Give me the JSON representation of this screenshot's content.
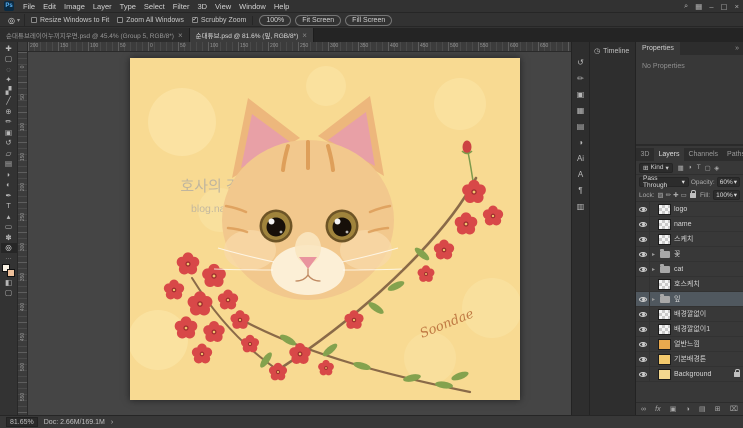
{
  "glyphs": {
    "caret_down": "▾",
    "group_caret": "▸",
    "collapse": "»",
    "tab_close": "×",
    "check": "✓",
    "status_arrow": "›",
    "kind_icon": "⊞"
  },
  "colors": {
    "canvas_yellow": "#f8da92",
    "flower_red": "#d84848",
    "leaf_green": "#84a24e",
    "cat_fur": "#f2c88d",
    "selection_gray": "#50585f"
  },
  "menubar": {
    "logo": "Ps",
    "items": [
      "File",
      "Edit",
      "Image",
      "Layer",
      "Type",
      "Select",
      "Filter",
      "3D",
      "View",
      "Window",
      "Help"
    ],
    "right_icons": [
      {
        "name": "search-icon",
        "glyph": "⌕"
      },
      {
        "name": "workspace-icon",
        "glyph": "▦"
      },
      {
        "name": "minimize-icon",
        "glyph": "–"
      },
      {
        "name": "restore-icon",
        "glyph": "▢"
      },
      {
        "name": "close-icon",
        "glyph": "×"
      }
    ]
  },
  "options_bar": {
    "tool_glyph": "◎",
    "checkboxes": [
      {
        "label": "Resize Windows to Fit",
        "checked": false
      },
      {
        "label": "Zoom All Windows",
        "checked": false
      },
      {
        "label": "Scrubby Zoom",
        "checked": true
      }
    ],
    "buttons": [
      "100%",
      "Fit Screen",
      "Fill Screen"
    ]
  },
  "tabs": [
    {
      "label": "순대튜브레이어누끼지우면.psd @ 45.4% (Group 5, RGB/8*)",
      "active": false
    },
    {
      "label": "순대튜브.psd @ 81.6% (잎, RGB/8*)",
      "active": true
    }
  ],
  "toolbar": {
    "tools": [
      {
        "name": "move-tool",
        "glyph": "✚",
        "selected": false
      },
      {
        "name": "marquee-tool",
        "glyph": "▢",
        "selected": false
      },
      {
        "name": "lasso-tool",
        "glyph": "◌",
        "selected": false
      },
      {
        "name": "quick-selection-tool",
        "glyph": "✦",
        "selected": false
      },
      {
        "name": "crop-tool",
        "glyph": "▞",
        "selected": false
      },
      {
        "name": "eyedropper-tool",
        "glyph": "╱",
        "selected": false
      },
      {
        "name": "healing-brush-tool",
        "glyph": "⊕",
        "selected": false
      },
      {
        "name": "brush-tool",
        "glyph": "✏",
        "selected": false
      },
      {
        "name": "clone-stamp-tool",
        "glyph": "▣",
        "selected": false
      },
      {
        "name": "history-brush-tool",
        "glyph": "↺",
        "selected": false
      },
      {
        "name": "eraser-tool",
        "glyph": "▱",
        "selected": false
      },
      {
        "name": "gradient-tool",
        "glyph": "▤",
        "selected": false
      },
      {
        "name": "blur-tool",
        "glyph": "◗",
        "selected": false
      },
      {
        "name": "dodge-tool",
        "glyph": "◐",
        "selected": false
      },
      {
        "name": "pen-tool",
        "glyph": "✒",
        "selected": false
      },
      {
        "name": "type-tool",
        "glyph": "T",
        "selected": false
      },
      {
        "name": "path-selection-tool",
        "glyph": "▴",
        "selected": false
      },
      {
        "name": "shape-tool",
        "glyph": "▭",
        "selected": false
      },
      {
        "name": "hand-tool",
        "glyph": "✽",
        "selected": false
      },
      {
        "name": "zoom-tool",
        "glyph": "◎",
        "selected": true
      }
    ],
    "more_glyph": "…",
    "extras": [
      {
        "name": "quick-mask-button",
        "glyph": "◧"
      },
      {
        "name": "screen-mode-button",
        "glyph": "▢"
      }
    ]
  },
  "rulers": {
    "top_labels": [
      "200",
      "150",
      "100",
      "50",
      "0",
      "50",
      "100",
      "150",
      "200",
      "250",
      "300",
      "350",
      "400",
      "450",
      "500",
      "550",
      "600",
      "650"
    ],
    "left_labels": [
      "0",
      "50",
      "100",
      "150",
      "200",
      "250",
      "300",
      "350",
      "400",
      "450",
      "500",
      "550"
    ]
  },
  "canvas": {
    "watermark1": "호사의 감각 - 호랑Lab",
    "watermark2": "blog.naver.com/mmm429",
    "signature": "Soondae"
  },
  "docks": {
    "timeline_glyph": "◷",
    "timeline_label": "Timeline",
    "panel_icons": [
      {
        "name": "history-panel-icon",
        "glyph": "↺"
      },
      {
        "name": "brushes-panel-icon",
        "glyph": "✏"
      },
      {
        "name": "clone-source-panel-icon",
        "glyph": "▣"
      },
      {
        "name": "swatches-panel-icon",
        "glyph": "▦"
      },
      {
        "name": "patterns-panel-icon",
        "glyph": "▤"
      },
      {
        "name": "adjustments-panel-icon",
        "glyph": "◑"
      },
      {
        "name": "libraries-panel-icon",
        "glyph": "Ai"
      },
      {
        "name": "character-panel-icon",
        "glyph": "A"
      },
      {
        "name": "paragraph-panel-icon",
        "glyph": "¶"
      },
      {
        "name": "navigator-panel-icon",
        "glyph": "▥"
      }
    ]
  },
  "properties": {
    "title": "Properties",
    "empty_text": "No Properties"
  },
  "layers_panel": {
    "tabs": [
      {
        "label": "3D",
        "active": false
      },
      {
        "label": "Layers",
        "active": true
      },
      {
        "label": "Channels",
        "active": false
      },
      {
        "label": "Paths",
        "active": false
      }
    ],
    "kind_label": "Kind",
    "filter_icons": [
      {
        "name": "pixel-layer-filter-icon",
        "glyph": "▦"
      },
      {
        "name": "adjustment-layer-filter-icon",
        "glyph": "◑"
      },
      {
        "name": "type-layer-filter-icon",
        "glyph": "T"
      },
      {
        "name": "shape-layer-filter-icon",
        "glyph": "▢"
      },
      {
        "name": "smart-object-filter-icon",
        "glyph": "◈"
      }
    ],
    "blend_mode": "Pass Through",
    "opacity_label": "Opacity:",
    "opacity_value": "60%",
    "lock_label": "Lock:",
    "lock_icons": [
      {
        "name": "lock-transparency-icon",
        "glyph": "▨"
      },
      {
        "name": "lock-pixels-icon",
        "glyph": "✏"
      },
      {
        "name": "lock-position-icon",
        "glyph": "✚"
      },
      {
        "name": "lock-artboard-icon",
        "glyph": "▭"
      }
    ],
    "fill_label": "Fill:",
    "fill_value": "100%",
    "rows": [
      {
        "name": "logo",
        "kind": "px"
      },
      {
        "name": "name",
        "kind": "px"
      },
      {
        "name": "스케치",
        "kind": "px"
      },
      {
        "name": "꽃",
        "kind": "group"
      },
      {
        "name": "cat",
        "kind": "group"
      },
      {
        "name": "호스케치",
        "kind": "px",
        "hidden": true
      },
      {
        "name": "잎",
        "kind": "group",
        "selected": true
      },
      {
        "name": "배경깔없이",
        "kind": "px"
      },
      {
        "name": "배경깔없이1",
        "kind": "px"
      },
      {
        "name": "얼반느낌",
        "kind": "fill",
        "color": "#e9a94e"
      },
      {
        "name": "기본배경톤",
        "kind": "fill",
        "color": "#f3c96d"
      },
      {
        "name": "Background",
        "kind": "background",
        "color": "#f3d78f",
        "locked": true
      }
    ],
    "bottom_icons": [
      {
        "name": "link-layers-icon",
        "glyph": "∞"
      },
      {
        "name": "layer-effects-icon",
        "glyph": "fx"
      },
      {
        "name": "layer-mask-icon",
        "glyph": "▣"
      },
      {
        "name": "adjustment-layer-icon",
        "glyph": "◑"
      },
      {
        "name": "new-group-icon",
        "glyph": "▤"
      },
      {
        "name": "new-layer-icon",
        "glyph": "⊞"
      },
      {
        "name": "delete-layer-icon",
        "glyph": "⌧"
      }
    ]
  },
  "statusbar": {
    "zoom": "81.65%",
    "doc_info": "Doc: 2.66M/169.1M"
  }
}
